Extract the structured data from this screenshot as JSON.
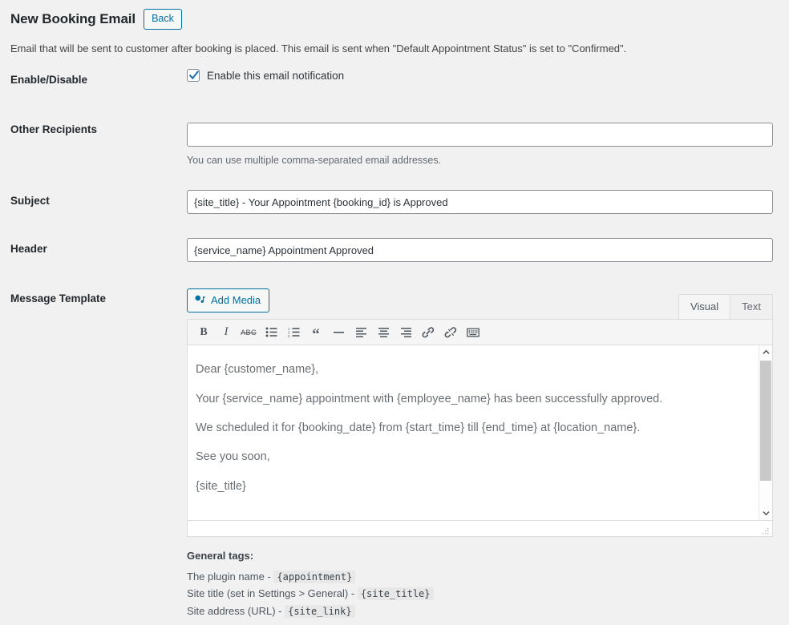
{
  "header": {
    "title": "New Booking Email",
    "back_label": "Back",
    "description": "Email that will be sent to customer after booking is placed. This email is sent when \"Default Appointment Status\" is set to \"Confirmed\"."
  },
  "colors": {
    "accent": "#0071a1",
    "page_bg": "#f1f1f1",
    "border": "#dcdcde",
    "label_text": "#23282d"
  },
  "fields": {
    "enable": {
      "label": "Enable/Disable",
      "checkbox_label": "Enable this email notification",
      "checked": true
    },
    "recipients": {
      "label": "Other Recipients",
      "value": "",
      "placeholder": "",
      "hint": "You can use multiple comma-separated email addresses."
    },
    "subject": {
      "label": "Subject",
      "value": "{site_title} - Your Appointment {booking_id} is Approved"
    },
    "header_field": {
      "label": "Header",
      "value": "{service_name} Appointment Approved"
    },
    "message": {
      "label": "Message Template"
    }
  },
  "editor": {
    "add_media_label": "Add Media",
    "tabs": [
      {
        "label": "Visual",
        "active": true
      },
      {
        "label": "Text",
        "active": false
      }
    ],
    "toolbar": [
      {
        "name": "bold-icon",
        "glyph": "B"
      },
      {
        "name": "italic-icon",
        "glyph": "I"
      },
      {
        "name": "strikethrough-icon",
        "glyph": "ABC"
      },
      {
        "name": "bullet-list-icon",
        "glyph": ""
      },
      {
        "name": "numbered-list-icon",
        "glyph": ""
      },
      {
        "name": "blockquote-icon",
        "glyph": "“"
      },
      {
        "name": "horizontal-rule-icon",
        "glyph": ""
      },
      {
        "name": "align-left-icon",
        "glyph": ""
      },
      {
        "name": "align-center-icon",
        "glyph": ""
      },
      {
        "name": "align-right-icon",
        "glyph": ""
      },
      {
        "name": "insert-link-icon",
        "glyph": ""
      },
      {
        "name": "remove-link-icon",
        "glyph": ""
      },
      {
        "name": "toolbar-toggle-icon",
        "glyph": ""
      }
    ],
    "body": [
      "Dear {customer_name},",
      "Your {service_name} appointment with {employee_name} has been successfully approved.",
      "We scheduled it for {booking_date} from {start_time} till {end_time} at {location_name}.",
      "See you soon,",
      "{site_title}"
    ]
  },
  "tags": {
    "title": "General tags:",
    "items": [
      {
        "desc": "The plugin name -",
        "code": "{appointment}"
      },
      {
        "desc": "Site title (set in Settings > General) -",
        "code": "{site_title}"
      },
      {
        "desc": "Site address (URL) -",
        "code": "{site_link}"
      }
    ]
  }
}
